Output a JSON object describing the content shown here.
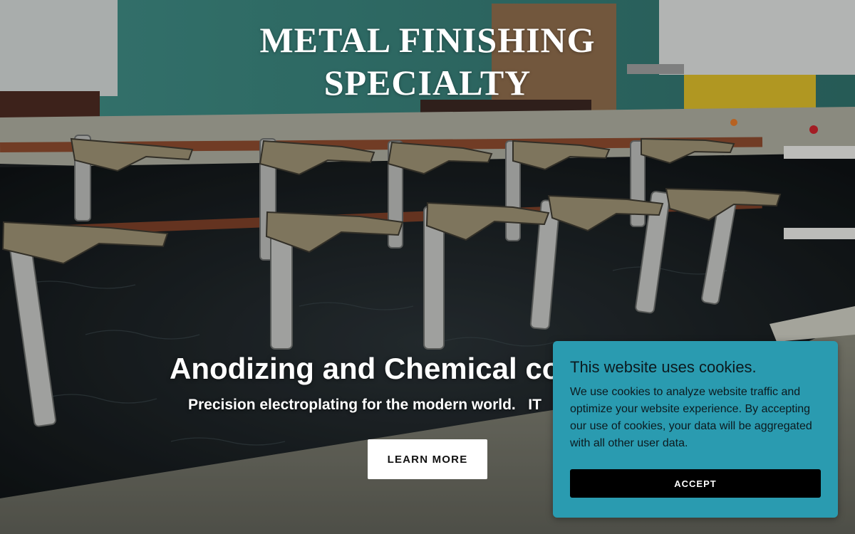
{
  "hero": {
    "site_title_line1": "METAL FINISHING",
    "site_title_line2": "SPECIALTY",
    "tagline": "Anodizing and Chemical co",
    "subtagline": "Precision electroplating for the modern world.   IT",
    "cta_label": "LEARN MORE"
  },
  "cookie_banner": {
    "title": "This website uses cookies.",
    "body": "We use cookies to analyze website traffic and optimize your website experience. By accepting our use of cookies, your data will be aggregated with all other user data.",
    "accept_label": "ACCEPT",
    "background_color": "#2a9bb0"
  }
}
